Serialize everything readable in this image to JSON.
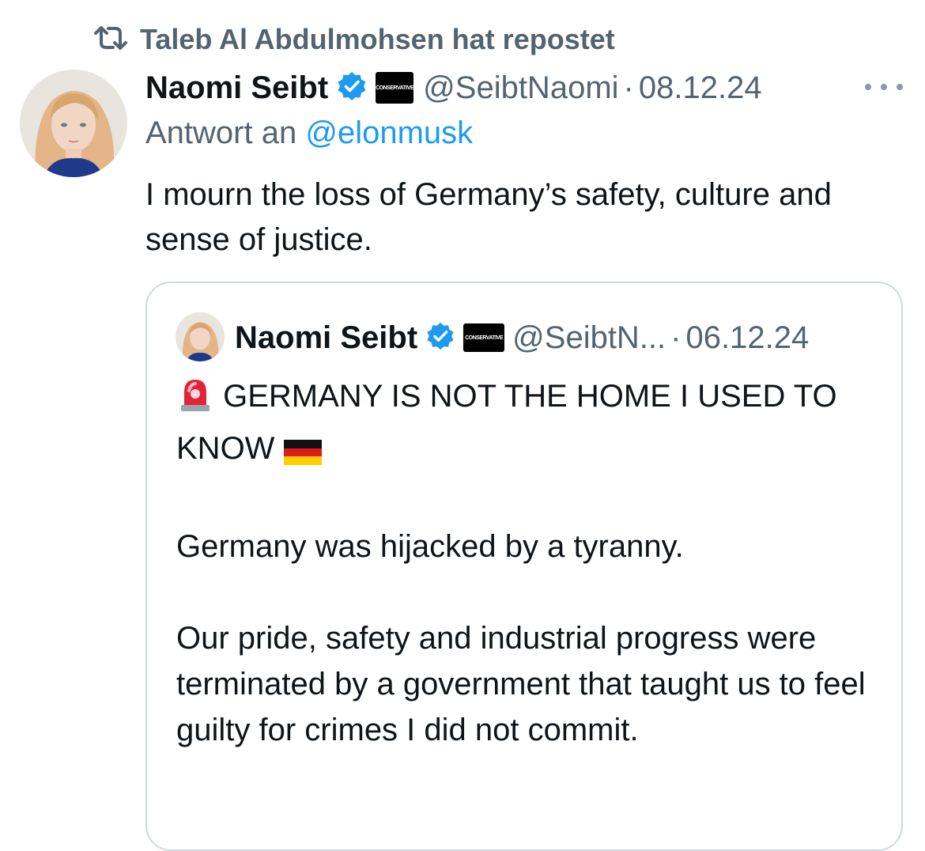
{
  "repost": {
    "icon": "repost-icon",
    "text": "Taleb Al Abdulmohsen hat repostet"
  },
  "post": {
    "author_name": "Naomi Seibt",
    "verified_icon": "verified-badge-icon",
    "affiliate_badge": "CONSERVATIVE",
    "handle": "@SeibtNaomi",
    "separator": "·",
    "date": "08.12.24",
    "more_icon": "more-options-icon",
    "reply_prefix": "Antwort an",
    "reply_mention": "@elonmusk",
    "text": "I mourn the loss of Germany’s safety, culture and sense of justice."
  },
  "quote": {
    "author_name": "Naomi Seibt",
    "affiliate_badge": "CONSERVATIVE",
    "handle": "@SeibtN...",
    "separator": "·",
    "date": "06.12.24",
    "line1_icon": "rotating-light-icon",
    "line1": "GERMANY IS NOT THE HOME I USED TO KNOW",
    "line1_flag": "germany-flag-icon",
    "paragraph2": "Germany was hijacked by a tyranny.",
    "paragraph3": "Our pride, safety and industrial progress were terminated by a government that taught us to feel guilty for crimes I did not commit."
  },
  "colors": {
    "text": "#0f1419",
    "secondary": "#536471",
    "accent": "#1d9bf0",
    "border": "#cfd9de"
  }
}
